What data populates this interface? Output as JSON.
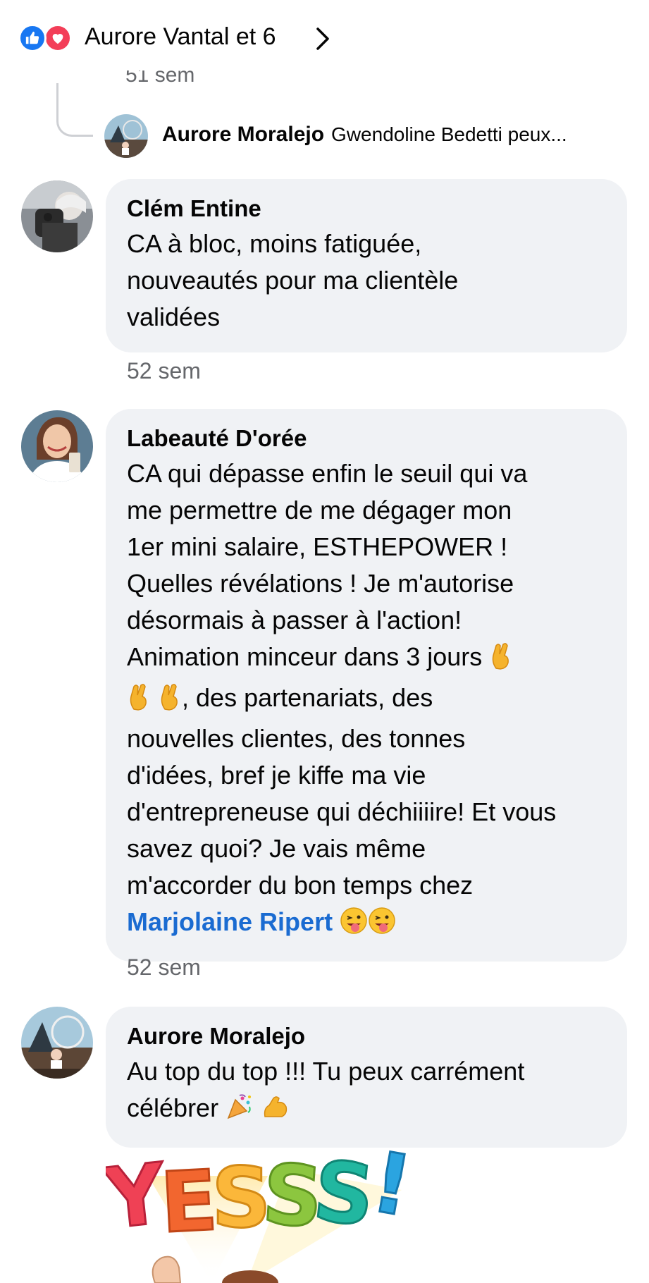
{
  "header": {
    "reaction_icons": [
      "like-icon",
      "love-icon"
    ],
    "title": "Aurore Vantal et 6",
    "chevron": "chevron-right-icon"
  },
  "previous_reply": {
    "time_partial": "51 sem",
    "author": "Aurore Moralejo",
    "text": "Gwendoline Bedetti peux..."
  },
  "comments": [
    {
      "author": "Clém Entine",
      "text_lines": [
        "CA à bloc, moins fatiguée,",
        "nouveautés pour ma clientèle",
        "validées"
      ],
      "time": "52 sem"
    },
    {
      "author": "Labeauté D'orée",
      "text_lines": [
        "CA qui dépasse enfin le seuil qui va",
        "me permettre de me dégager mon",
        "1er mini salaire, ESTHEPOWER !",
        "Quelles révélations !  Je m'autorise",
        "désormais à passer à l'action!",
        "Animation minceur dans 3 jours",
        ", des partenariats, des",
        "nouvelles clientes, des tonnes",
        "d'idées, bref je kiffe ma vie",
        "d'entrepreneuse qui déchiiiire! Et vous",
        "savez quoi? Je vais même",
        "m'accorder du bon temps chez"
      ],
      "mention": "Marjolaine Ripert",
      "time": "52 sem"
    },
    {
      "author": "Aurore Moralejo",
      "text_lines": [
        "Au top du top !!! Tu peux carrément",
        "célébrer"
      ]
    }
  ],
  "sticker": {
    "letters": [
      "Y",
      "E",
      "S",
      "S",
      "S",
      "!"
    ]
  },
  "colors": {
    "bubble": "#f0f2f5",
    "meta_text": "#65676b",
    "mention": "#1a6bd1",
    "like": "#1877f2",
    "love": "#f33e58"
  }
}
